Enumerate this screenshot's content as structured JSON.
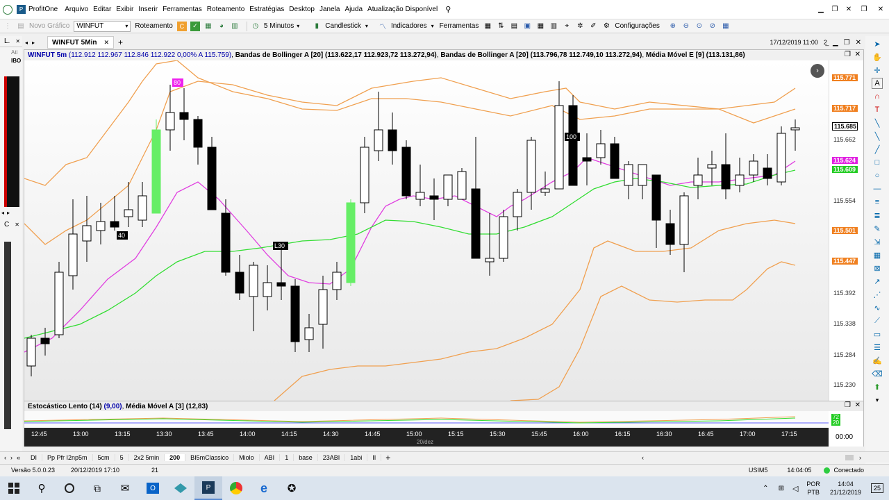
{
  "app": {
    "title": "ProfitOne",
    "menu": [
      "Arquivo",
      "Editar",
      "Exibir",
      "Inserir",
      "Ferramentas",
      "Roteamento",
      "Estratégias",
      "Desktop",
      "Janela",
      "Ajuda",
      "Atualização Disponível"
    ]
  },
  "toolbar": {
    "new_chart": "Novo Gráfico",
    "symbol": "WINFUT",
    "routing": "Roteamento",
    "interval": "5 Minutos",
    "chart_type": "Candlestick",
    "indicators": "Indicadores",
    "tools": "Ferramentas",
    "settings": "Configurações",
    "datetime": "17/12/2019 11:00"
  },
  "left_panel": {
    "label1": "L.",
    "label2": "Ati",
    "label3": "IBO",
    "label4": "C"
  },
  "tab": {
    "label": "WINFUT 5Min",
    "add": "+"
  },
  "chart": {
    "header_symbol": "WINFUT 5m",
    "header_ohlc": "(112.912  112.967  112.846  112.922  0,00%  A  115.759)",
    "indicator1": "Bandas de Bollinger A [20]",
    "indicator1_values": "(113.622,17  112.923,72 113.272,94)",
    "indicator2": "Bandas de Bollinger A [20]",
    "indicator2_values": "(113.796,78  112.749,10 113.272,94)",
    "indicator3": "Média Móvel E [9]",
    "indicator3_values": "(113.131,86)",
    "price_labels": [
      {
        "text": "115.771",
        "style": "orange"
      },
      {
        "text": "115.717",
        "style": "orange"
      },
      {
        "text": "115.685",
        "style": "black"
      },
      {
        "text": "115.662",
        "style": "plain"
      },
      {
        "text": "115.624",
        "style": "magenta"
      },
      {
        "text": "115.609",
        "style": "green"
      },
      {
        "text": "115.554",
        "style": "plain"
      },
      {
        "text": "115.501",
        "style": "orange"
      },
      {
        "text": "115.447",
        "style": "orange"
      },
      {
        "text": "115.392",
        "style": "plain"
      },
      {
        "text": "115.338",
        "style": "plain"
      },
      {
        "text": "115.284",
        "style": "plain"
      },
      {
        "text": "115.230",
        "style": "plain"
      }
    ],
    "annotations": [
      {
        "text": "80",
        "style": "magenta"
      },
      {
        "text": "40",
        "style": "black"
      },
      {
        "text": "L30",
        "style": "black"
      },
      {
        "text": "100",
        "style": "black"
      }
    ],
    "stoch_title": "Estocástico Lento (14)",
    "stoch_value": "(9,00)",
    "stoch_ma": "Média Móvel A [3]",
    "stoch_ma_value": "(12,83)",
    "stoch_labels": [
      "72",
      "20"
    ],
    "time_labels": [
      "12:45",
      "13:00",
      "13:15",
      "13:30",
      "13:45",
      "14:00",
      "14:15",
      "14:30",
      "14:45",
      "15:00",
      "15:15",
      "15:30",
      "15:45",
      "16:00",
      "16:15",
      "16:30",
      "16:45",
      "17:00",
      "17:15"
    ],
    "date_label": "20/dez",
    "time_right": "00:00"
  },
  "bottom_tabs": [
    "DI",
    "Pp Pfr I2np5m",
    "5cm",
    "5",
    "2x2 5min",
    "200",
    "BI5mClassico",
    "Miolo",
    "ABI",
    "1",
    "base",
    "23ABI",
    "1abi",
    "II"
  ],
  "statusbar": {
    "version": "Versão 5.0.0.23",
    "date": "20/12/2019 17:10",
    "count": "21",
    "symbol": "USIM5",
    "clock": "14:04:05",
    "status": "Conectado"
  },
  "taskbar": {
    "lang1": "POR",
    "lang2": "PTB",
    "time": "14:04",
    "date": "21/12/2019",
    "notif": "25"
  },
  "colors": {
    "bull": "#ffffff",
    "bear": "#000000",
    "highlight": "#66ee66",
    "bollinger": "#f0a050",
    "ema": "#e040e0",
    "ma_green": "#33dd33",
    "connected": "#2ecc40"
  }
}
